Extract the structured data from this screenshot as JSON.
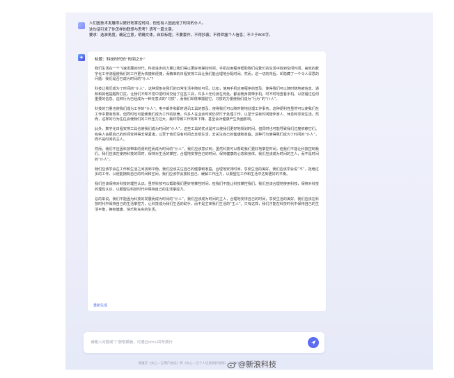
{
  "user": {
    "lines": [
      "人们因技术发展得以更好地掌控时间，但也有人因此成了时间的仆人。",
      "这句话引发了你怎样的联想与思考？请写一篇文章。",
      "要求：选准角度，确定立意，明确文体，自拟标题；不要套作，不得抄袭；不得泄露个人信息；不少于800字。"
    ]
  },
  "answer": {
    "title": "标题：科技时代的“时间之仆”",
    "paragraphs": [
      "我们生活在一个飞速发展的时代，科技进步的力量让我们得以更好地掌控时间。手机应用程序帮助我们在繁忙的生活中找到空闲时间，高效的数字化工作流程使我们的工作更为快捷和便捷，而精准的日程安排工具让我们能合理地分配时间。然而，这一切的背后，却隐藏了一个令人深思的问题：我们是否已成为时间的“仆人”？",
      "科技让我们成为了时间的“仆人”，这种现象在我们的日常生活中随处可见。比如，使用手机应用程序的普及，使得我们可以随时随地被信息、通知和其他提醒所打扰，让我们不知不觉中把时间交给了这些工具，许多人无论身在何处，都会随身携带手机，时不时地查看手机，以防错过任何重要的信息。这种行为已经成为一种无意识的“习惯”，而我们却很难摆脱它，习惯的力量使我们成为“行为”的“仆人”。",
      "科技的力量也使我们成为工作的“仆人”。电子邮件和即时通讯工具的普及，使得我们可以随时随地处理工作事务。这种便利性虽然可以使我们在工作中更有效率，但同时也可能使我们成为工作的奴隶。许多人在业余时间仍然忙于处理工作，以至于没有时间陪伴家人、休息和享受生活。然而，这样的行为往往会使我们的工作压力过大，最终导致工作效率下降，甚至会对健康产生负面影响。",
      "此外，数字化日程安排工具也使我们成为时间的“仆人”。这些工具的优点是可以使我们更好地规划时间，但同时也可能导致我们过度依赖它们。有些人会把自己的时间安排得非常紧凑，以至于他们没有时间去享受生活，去关注自己的健康和家庭。这种行为使得我们成为了时间的“仆人”，而不是时间的主人。",
      "然而，我们不应因科技带来的便利性而成为时间的“仆人”。我们应该意识到，虽然科技可以帮助我们更好地掌控时间，但我们不能让科技控制我们。我们应该在使用科技的同时，保持对生活的掌控，合理地安排自己的时间，保持健康的心态和身体。我们应该成为时间的主人，而不是时间的“仆人”。",
      "我们应该学会在工作和生活之间找到平衡。我们应该关注自己的健康和家庭，合理地安排时间，享受生活的美好。我们应该学会说“不”，拒绝过多的工作，以便能拥有自己的时间和空间。我们应该学会放松自己，缓解工作压力，以期望在工作和生活中达到更好的平衡。",
      "我们应该保持对科技的理性认识。虽然科技可以帮助我们更好地掌控时间，但我们不能让科技掌控我们。我们应该合理地使用科技，保持对科技的理性认识，以期望在科技时代中保持自己的生活掌控力。",
      "总的来说，我们不能因为科技的发展而成为时间的“仆人”。我们应该成为时间的主人，合理地安排自己的时间，享受生活的美好。我们应该在科技时代中保持自己的生活掌控力，让科技成为我们生活的助手，而不是主宰我们生活的“主人”。只有这样，我们才能在科技时代中保持自己的生活平衡，拥有健康、快乐和充实的生活。"
    ],
    "regenerate_label": "重新生成"
  },
  "input": {
    "placeholder": "请输入问题或“/”获取模板，可通过ctrl+回车换行"
  },
  "footer": {
    "text": "请遵守《文心一言用户协议》和《文心一言个人信息保护规则》  2023/05/31  版本号：V2.0.2"
  },
  "watermark": {
    "text": "@新浪科技"
  },
  "colors": {
    "accent": "#5b6cf2",
    "link": "#4f6bed"
  }
}
